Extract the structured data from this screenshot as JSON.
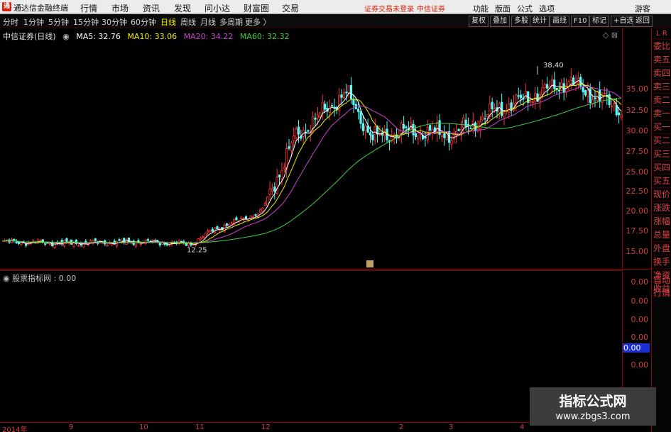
{
  "app": {
    "logo": "通",
    "title": "通达信金融终端"
  },
  "menu": [
    {
      "label": "行情"
    },
    {
      "label": "市场"
    },
    {
      "label": "资讯"
    },
    {
      "label": "发现"
    },
    {
      "label": "问小达"
    },
    {
      "label": "财富圈"
    },
    {
      "label": "交易"
    }
  ],
  "notice": {
    "login": "证券交易未登录",
    "broker": "中信证券"
  },
  "menu_right": [
    {
      "label": "功能"
    },
    {
      "label": "版面"
    },
    {
      "label": "公式"
    },
    {
      "label": "选项"
    },
    {
      "label": "游客"
    }
  ],
  "periods": [
    {
      "label": "分时"
    },
    {
      "label": "1分钟"
    },
    {
      "label": "5分钟"
    },
    {
      "label": "15分钟"
    },
    {
      "label": "30分钟"
    },
    {
      "label": "60分钟"
    },
    {
      "label": "日线",
      "active": true
    },
    {
      "label": "周线"
    },
    {
      "label": "月线"
    },
    {
      "label": "多周期"
    },
    {
      "label": "更多 〉"
    }
  ],
  "toolbar_right": [
    {
      "label": "复权"
    },
    {
      "label": "叠加"
    },
    {
      "label": "多股"
    },
    {
      "label": "统计"
    },
    {
      "label": "画线"
    },
    {
      "label": "F10"
    },
    {
      "label": "标记"
    },
    {
      "label": "+自选"
    },
    {
      "label": "返回"
    }
  ],
  "stock": {
    "title": "中信证券(日线)"
  },
  "ma_legend": [
    {
      "label": "MA5: 32.76",
      "color": "#ffffff"
    },
    {
      "label": "MA10: 33.06",
      "color": "#f0f000"
    },
    {
      "label": "MA20: 34.22",
      "color": "#d040d0"
    },
    {
      "label": "MA60: 32.32",
      "color": "#40d040"
    }
  ],
  "price_ticks": [
    "35.00",
    "32.50",
    "30.00",
    "27.50",
    "25.00",
    "22.50",
    "20.00",
    "17.50",
    "15.00"
  ],
  "annotations": {
    "high": "38.40",
    "low": "12.25",
    "marker": "榜"
  },
  "side_tabs": [
    "委比",
    "卖五",
    "卖四",
    "卖三",
    "卖二",
    "卖一",
    "买一",
    "买二",
    "买三",
    "买四",
    "买五",
    "现价",
    "涨跌",
    "涨幅",
    "总量",
    "外盘",
    "换手",
    "净资",
    "收益"
  ],
  "side_top": "L R",
  "side_auto": [
    "自动",
    "行情"
  ],
  "indicator": {
    "label": "股票指标网 : 0.00",
    "ticks": [
      "0.00",
      "0.00",
      "0.00",
      "0.00",
      "0.00"
    ],
    "highlight": "0.00"
  },
  "time_labels": [
    "2014年",
    "9",
    "10",
    "11",
    "12",
    "2",
    "3",
    "4"
  ],
  "watermark": {
    "line1": "指标公式网",
    "line2": "www.zbgs3.com"
  },
  "chart_data": {
    "type": "candlestick",
    "title": "中信证券(日线)",
    "y_axis_ticks": [
      15.0,
      17.5,
      20.0,
      22.5,
      25.0,
      27.5,
      30.0,
      32.5,
      35.0
    ],
    "x_labels": [
      "2014年",
      "9",
      "10",
      "11",
      "12",
      "2",
      "3",
      "4"
    ],
    "approx_close_path": [
      {
        "x": "2014年",
        "close": 13.3
      },
      {
        "x": "9",
        "close": 13.1
      },
      {
        "x": "10",
        "close": 13.3
      },
      {
        "x": "11",
        "close": 13.0
      },
      {
        "x": "11 late",
        "close": 15.0
      },
      {
        "x": "12",
        "close": 17.5
      },
      {
        "x": "12 late",
        "close": 28.0
      },
      {
        "x": "1",
        "close": 34.5
      },
      {
        "x": "1 late",
        "close": 28.0
      },
      {
        "x": "2",
        "close": 29.0
      },
      {
        "x": "3",
        "close": 28.5
      },
      {
        "x": "3 late",
        "close": 32.0
      },
      {
        "x": "4",
        "close": 36.0
      },
      {
        "x": "4 late",
        "close": 32.0
      }
    ],
    "ma_last": {
      "MA5": 32.76,
      "MA10": 33.06,
      "MA20": 34.22,
      "MA60": 32.32
    },
    "high_marker": 38.4,
    "low_marker": 12.25
  }
}
